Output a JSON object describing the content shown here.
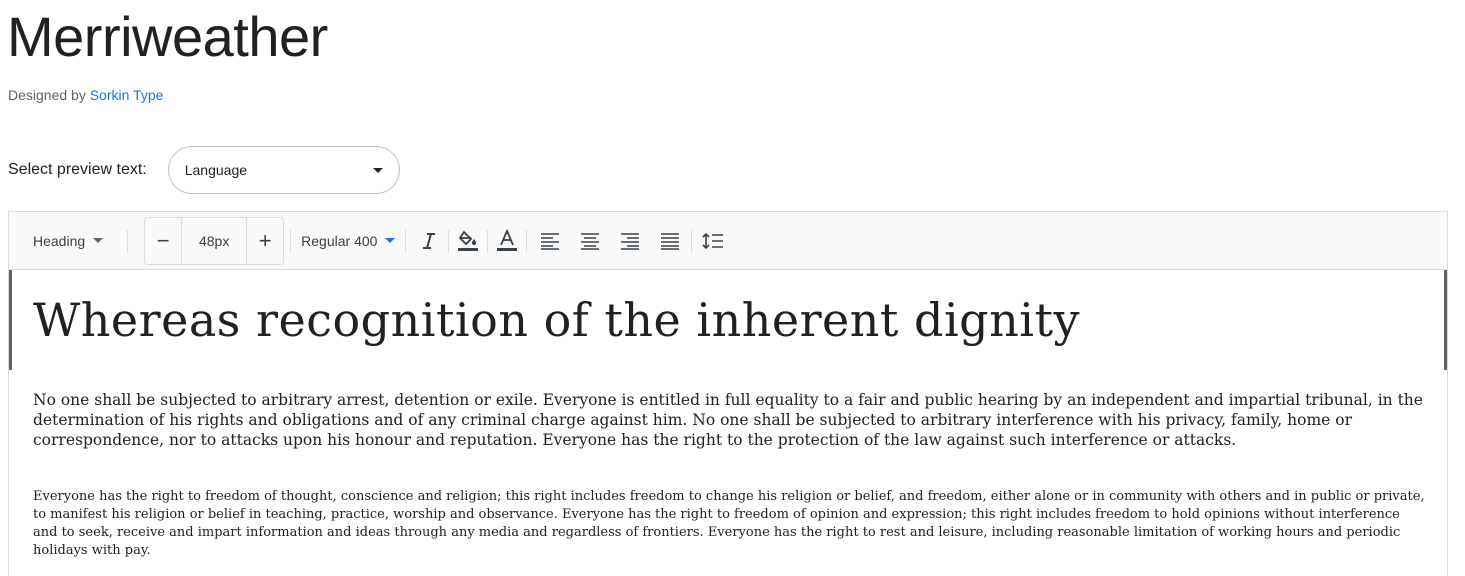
{
  "family": {
    "name": "Merriweather",
    "designed_by_prefix": "Designed by",
    "designer": "Sorkin Type"
  },
  "preview_select": {
    "label": "Select preview text:",
    "value": "Language"
  },
  "toolbar": {
    "style": "Heading",
    "size_decrease": "−",
    "size_value": "48px",
    "size_increase": "+",
    "weight": "Regular 400",
    "icons": [
      "italic-icon",
      "highlight-color-icon",
      "text-color-icon",
      "align-left-icon",
      "align-center-icon",
      "align-right-icon",
      "align-justify-icon",
      "line-height-icon"
    ],
    "accent_color": "#1a73e8"
  },
  "preview": {
    "heading": "Whereas recognition of the inherent dignity",
    "paragraph_1": "No one shall be subjected to arbitrary arrest, detention or exile. Everyone is entitled in full equality to a fair and public hearing by an independent and impartial tribunal, in the determination of his rights and obligations and of any criminal charge against him. No one shall be subjected to arbitrary interference with his privacy, family, home or correspondence, nor to attacks upon his honour and reputation. Everyone has the right to the protection of the law against such interference or attacks.",
    "paragraph_2": "Everyone has the right to freedom of thought, conscience and religion; this right includes freedom to change his religion or belief, and freedom, either alone or in community with others and in public or private, to manifest his religion or belief in teaching, practice, worship and observance. Everyone has the right to freedom of opinion and expression; this right includes freedom to hold opinions without interference and to seek, receive and impart information and ideas through any media and regardless of frontiers. Everyone has the right to rest and leisure, including reasonable limitation of working hours and periodic holidays with pay."
  }
}
